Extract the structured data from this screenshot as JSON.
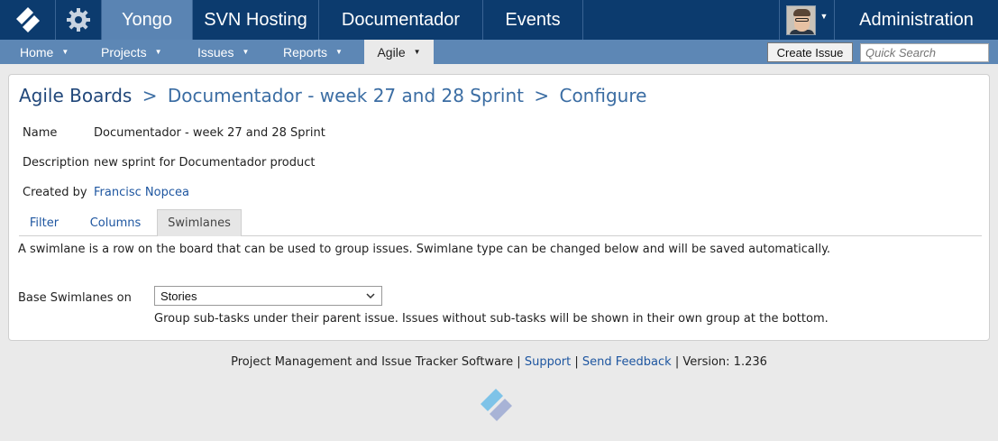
{
  "topnav": {
    "items": [
      "Yongo",
      "SVN Hosting",
      "Documentador",
      "Events"
    ],
    "admin_label": "Administration"
  },
  "subnav": {
    "items": [
      "Home",
      "Projects",
      "Issues",
      "Reports",
      "Agile"
    ],
    "create_issue_label": "Create Issue",
    "quick_search_placeholder": "Quick Search"
  },
  "breadcrumb": {
    "root": "Agile Boards",
    "board": "Documentador - week 27 and 28 Sprint",
    "current": "Configure",
    "separator": ">"
  },
  "details": {
    "name_label": "Name",
    "name_value": "Documentador - week 27 and 28 Sprint",
    "description_label": "Description",
    "description_value": "new sprint for Documentador product",
    "created_by_label": "Created by",
    "created_by_value": "Francisc Nopcea"
  },
  "tabs": [
    "Filter",
    "Columns",
    "Swimlanes"
  ],
  "active_tab": "Swimlanes",
  "swimlanes": {
    "intro": "A swimlane is a row on the board that can be used to group issues. Swimlane type can be changed below and will be saved automatically.",
    "base_label": "Base Swimlanes on",
    "selected": "Stories",
    "help": "Group sub-tasks under their parent issue. Issues without sub-tasks will be shown in their own group at the bottom."
  },
  "footer": {
    "product": "Project Management and Issue Tracker Software",
    "support": "Support",
    "feedback": "Send Feedback",
    "version": "Version: 1.236",
    "divider": "|"
  },
  "colors": {
    "topbar": "#0c3b6e",
    "active_top": "#5a84b3",
    "subnav": "#5d87b5",
    "link": "#1e56a0"
  }
}
